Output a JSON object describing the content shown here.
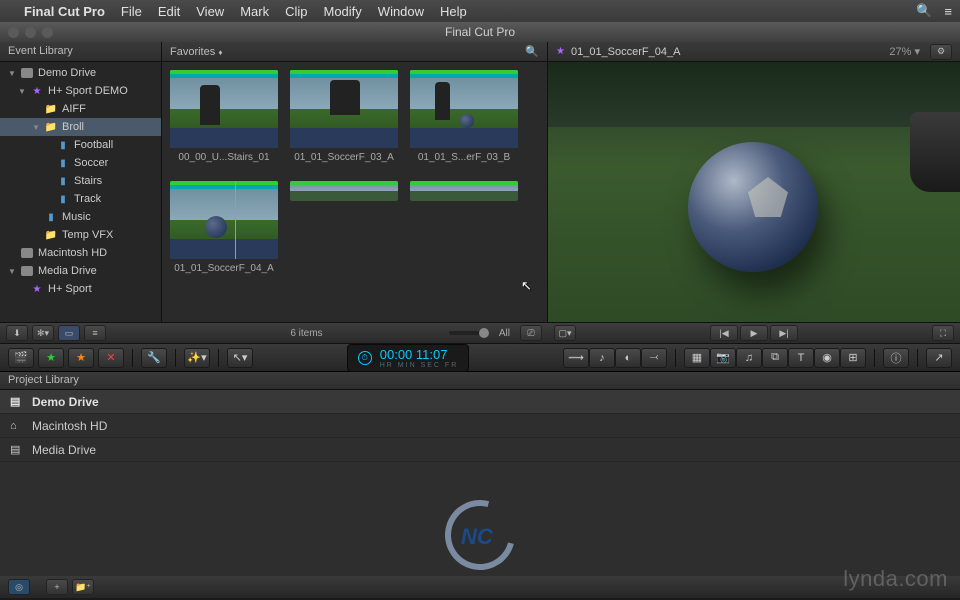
{
  "menubar": {
    "app": "Final Cut Pro",
    "items": [
      "File",
      "Edit",
      "View",
      "Mark",
      "Clip",
      "Modify",
      "Window",
      "Help"
    ]
  },
  "window": {
    "title": "Final Cut Pro"
  },
  "sidebar": {
    "title": "Event Library",
    "tree": [
      {
        "label": "Demo Drive",
        "type": "drive",
        "indent": 0,
        "open": true
      },
      {
        "label": "H+ Sport DEMO",
        "type": "star",
        "indent": 1,
        "open": true
      },
      {
        "label": "AIFF",
        "type": "folder",
        "indent": 2
      },
      {
        "label": "Broll",
        "type": "folder",
        "indent": 2,
        "sel": true,
        "open": true
      },
      {
        "label": "Football",
        "type": "clip",
        "indent": 3
      },
      {
        "label": "Soccer",
        "type": "clip",
        "indent": 3
      },
      {
        "label": "Stairs",
        "type": "clip",
        "indent": 3
      },
      {
        "label": "Track",
        "type": "clip",
        "indent": 3
      },
      {
        "label": "Music",
        "type": "clip",
        "indent": 2
      },
      {
        "label": "Temp VFX",
        "type": "folder",
        "indent": 2
      },
      {
        "label": "Macintosh HD",
        "type": "drive",
        "indent": 0
      },
      {
        "label": "Media Drive",
        "type": "drive",
        "indent": 0,
        "open": true
      },
      {
        "label": "H+ Sport",
        "type": "star",
        "indent": 1
      }
    ]
  },
  "browser": {
    "filter": "Favorites",
    "clips": [
      {
        "label": "00_00_U...Stairs_01"
      },
      {
        "label": "01_01_SoccerF_03_A"
      },
      {
        "label": "01_01_S...erF_03_B"
      },
      {
        "label": "01_01_SoccerF_04_A",
        "playhead": true
      }
    ],
    "count": "6 items",
    "all_label": "All"
  },
  "viewer": {
    "clip_name": "01_01_SoccerF_04_A",
    "zoom": "27%"
  },
  "timecode": {
    "display": "00:00 11:07",
    "sub": "HR  MIN  SEC  FR"
  },
  "project_library": {
    "title": "Project Library",
    "rows": [
      {
        "label": "Demo Drive",
        "icon": "drive",
        "bold": true
      },
      {
        "label": "Macintosh HD",
        "icon": "home",
        "bold": false
      },
      {
        "label": "Media Drive",
        "icon": "drive",
        "bold": false
      }
    ]
  },
  "watermark": "lynda.com"
}
